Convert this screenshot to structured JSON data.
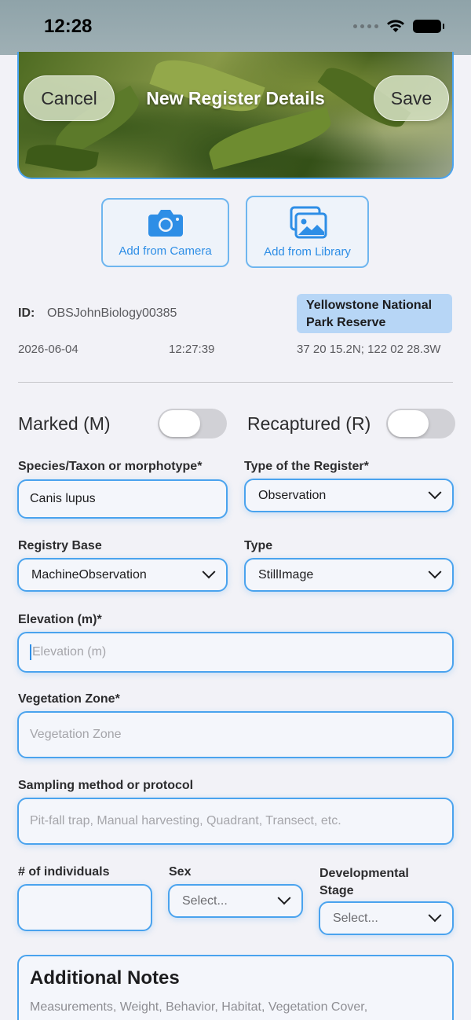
{
  "status_bar": {
    "time": "12:28"
  },
  "nav": {
    "cancel_label": "Cancel",
    "title": "New Register Details",
    "save_label": "Save"
  },
  "media": {
    "camera_label": "Add from Camera",
    "library_label": "Add from Library"
  },
  "record": {
    "id_label": "ID:",
    "id_value": "OBSJohnBiology00385",
    "location": "Yellowstone National Park Reserve",
    "date": "2026-06-04",
    "time": "12:27:39",
    "coordinates": "37 20 15.2N; 122 02 28.3W"
  },
  "toggles": {
    "marked_label": "Marked (M)",
    "marked_on": false,
    "recaptured_label": "Recaptured (R)",
    "recaptured_on": false
  },
  "form": {
    "species_label": "Species/Taxon or morphotype*",
    "species_value": "Canis lupus",
    "register_type_label": "Type of the Register*",
    "register_type_value": "Observation",
    "registry_base_label": "Registry Base",
    "registry_base_value": "MachineObservation",
    "type_label": "Type",
    "type_value": "StillImage",
    "elevation_label": "Elevation (m)*",
    "elevation_placeholder": "Elevation (m)",
    "vegetation_label": "Vegetation Zone*",
    "vegetation_placeholder": "Vegetation Zone",
    "sampling_label": "Sampling method or protocol",
    "sampling_placeholder": "Pit-fall trap, Manual harvesting, Quadrant, Transect, etc.",
    "individuals_label": "# of individuals",
    "sex_label": "Sex",
    "sex_value": "Select...",
    "stage_label": "Developmental Stage",
    "stage_value": "Select..."
  },
  "notes": {
    "title": "Additional Notes",
    "placeholder": "Measurements, Weight, Behavior, Habitat, Vegetation Cover,"
  },
  "colors": {
    "accent": "#2e8ee6",
    "border": "#4aa3ee",
    "badge": "#b7d6f6"
  }
}
